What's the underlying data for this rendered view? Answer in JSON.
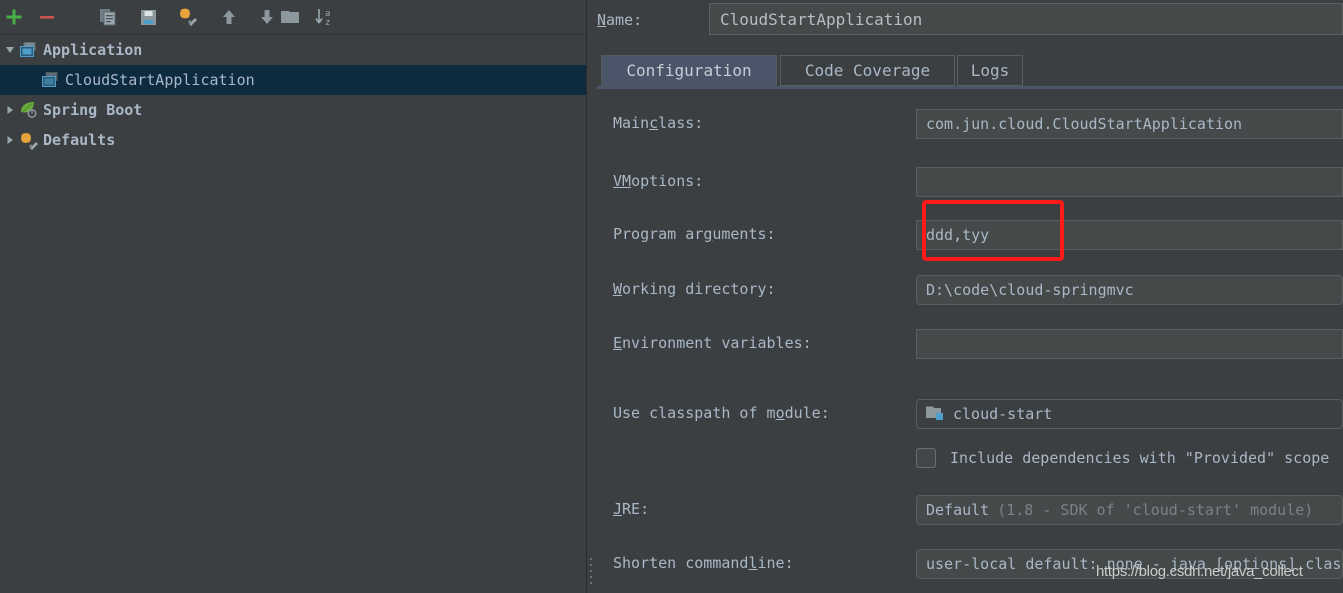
{
  "toolbar": {
    "buttons": [
      {
        "name": "add-configuration-button",
        "icon": "plus-icon",
        "tooltip": "Add New Configuration"
      },
      {
        "name": "remove-configuration-button",
        "icon": "minus-icon",
        "tooltip": "Remove Configuration"
      },
      {
        "name": "copy-configuration-button",
        "icon": "copy-icon",
        "tooltip": "Copy Configuration"
      },
      {
        "name": "save-configuration-button",
        "icon": "save-icon",
        "tooltip": "Save Configuration"
      },
      {
        "name": "edit-defaults-button",
        "icon": "gear-wrench-icon",
        "tooltip": "Edit Defaults"
      },
      {
        "name": "move-up-button",
        "icon": "arrow-up-icon",
        "tooltip": "Move Up"
      },
      {
        "name": "move-down-button",
        "icon": "arrow-down-icon",
        "tooltip": "Move Down"
      },
      {
        "name": "create-folder-button",
        "icon": "folder-icon",
        "tooltip": "Create New Folder"
      },
      {
        "name": "sort-configurations-button",
        "icon": "sort-alpha-icon",
        "tooltip": "Sort Configurations"
      }
    ]
  },
  "tree": {
    "items": [
      {
        "label": "Application",
        "icon": "application-run-icon",
        "expanded": true,
        "level": 0,
        "selected": false,
        "bold": true
      },
      {
        "label": "CloudStartApplication",
        "icon": "application-run-icon",
        "expanded": null,
        "level": 1,
        "selected": true,
        "bold": false
      },
      {
        "label": "Spring Boot",
        "icon": "spring-boot-icon",
        "expanded": false,
        "level": 0,
        "selected": false,
        "bold": true
      },
      {
        "label": "Defaults",
        "icon": "gear-wrench-icon",
        "expanded": false,
        "level": 0,
        "selected": false,
        "bold": true
      }
    ]
  },
  "name_field": {
    "label_prefix": "",
    "label_mnemonic": "N",
    "label_suffix": "ame:",
    "value": "CloudStartApplication",
    "placeholder": "Configuration name"
  },
  "tabs": [
    {
      "label": "Configuration",
      "active": true,
      "name": "tab-configuration"
    },
    {
      "label": "Code Coverage",
      "active": false,
      "name": "tab-code-coverage"
    },
    {
      "label": "Logs",
      "active": false,
      "name": "tab-logs"
    }
  ],
  "form": {
    "main_class": {
      "label_pre": "Main ",
      "label_mn": "c",
      "label_post": "lass:",
      "value": "com.jun.cloud.CloudStartApplication",
      "placeholder": ""
    },
    "vm_options": {
      "label_pre": "",
      "label_mn": "VM",
      "label_post": " options:",
      "value": "",
      "placeholder": ""
    },
    "program_arguments": {
      "label_pre": "Program ar",
      "label_mn": "g",
      "label_post": "uments:",
      "value": "ddd,tyy",
      "placeholder": ""
    },
    "working_directory": {
      "label_pre": "",
      "label_mn": "W",
      "label_post": "orking directory:",
      "value": "D:\\code\\cloud-springmvc",
      "placeholder": ""
    },
    "environment_variables": {
      "label_pre": "",
      "label_mn": "E",
      "label_post": "nvironment variables:",
      "value": "",
      "placeholder": ""
    },
    "use_classpath_of_module": {
      "label_pre": "Use classpath of m",
      "label_mn": "o",
      "label_post": "dule:",
      "value": "cloud-start",
      "icon": "module-folder-icon"
    },
    "include_provided_dependencies": {
      "label": "Include dependencies with \"Provided\" scope",
      "checked": false
    },
    "jre": {
      "label_pre": "",
      "label_mn": "J",
      "label_post": "RE:",
      "value": "Default",
      "value_dim": "(1.8 - SDK of 'cloud-start' module)"
    },
    "shorten_command_line": {
      "label_pre": "Shorten command ",
      "label_mn": "l",
      "label_post": "ine:",
      "value": "user-local default: none - java [options] classname [args]"
    }
  },
  "annotation": {
    "highlight_color": "#ff1a1a",
    "target": "program-arguments-input"
  },
  "watermark": {
    "text": "https://blog.csdn.net/java_collect"
  },
  "theme": {
    "background": "#3c3f41",
    "input_background": "#45494a",
    "text": "#a9b7c6",
    "dim_text": "#7b8185",
    "selection": "#0d2a3f",
    "tab_active": "#4b5569",
    "accent_green": "#4caf50",
    "accent_orange": "#e8a33d",
    "accent_blue": "#4d9ec9"
  }
}
